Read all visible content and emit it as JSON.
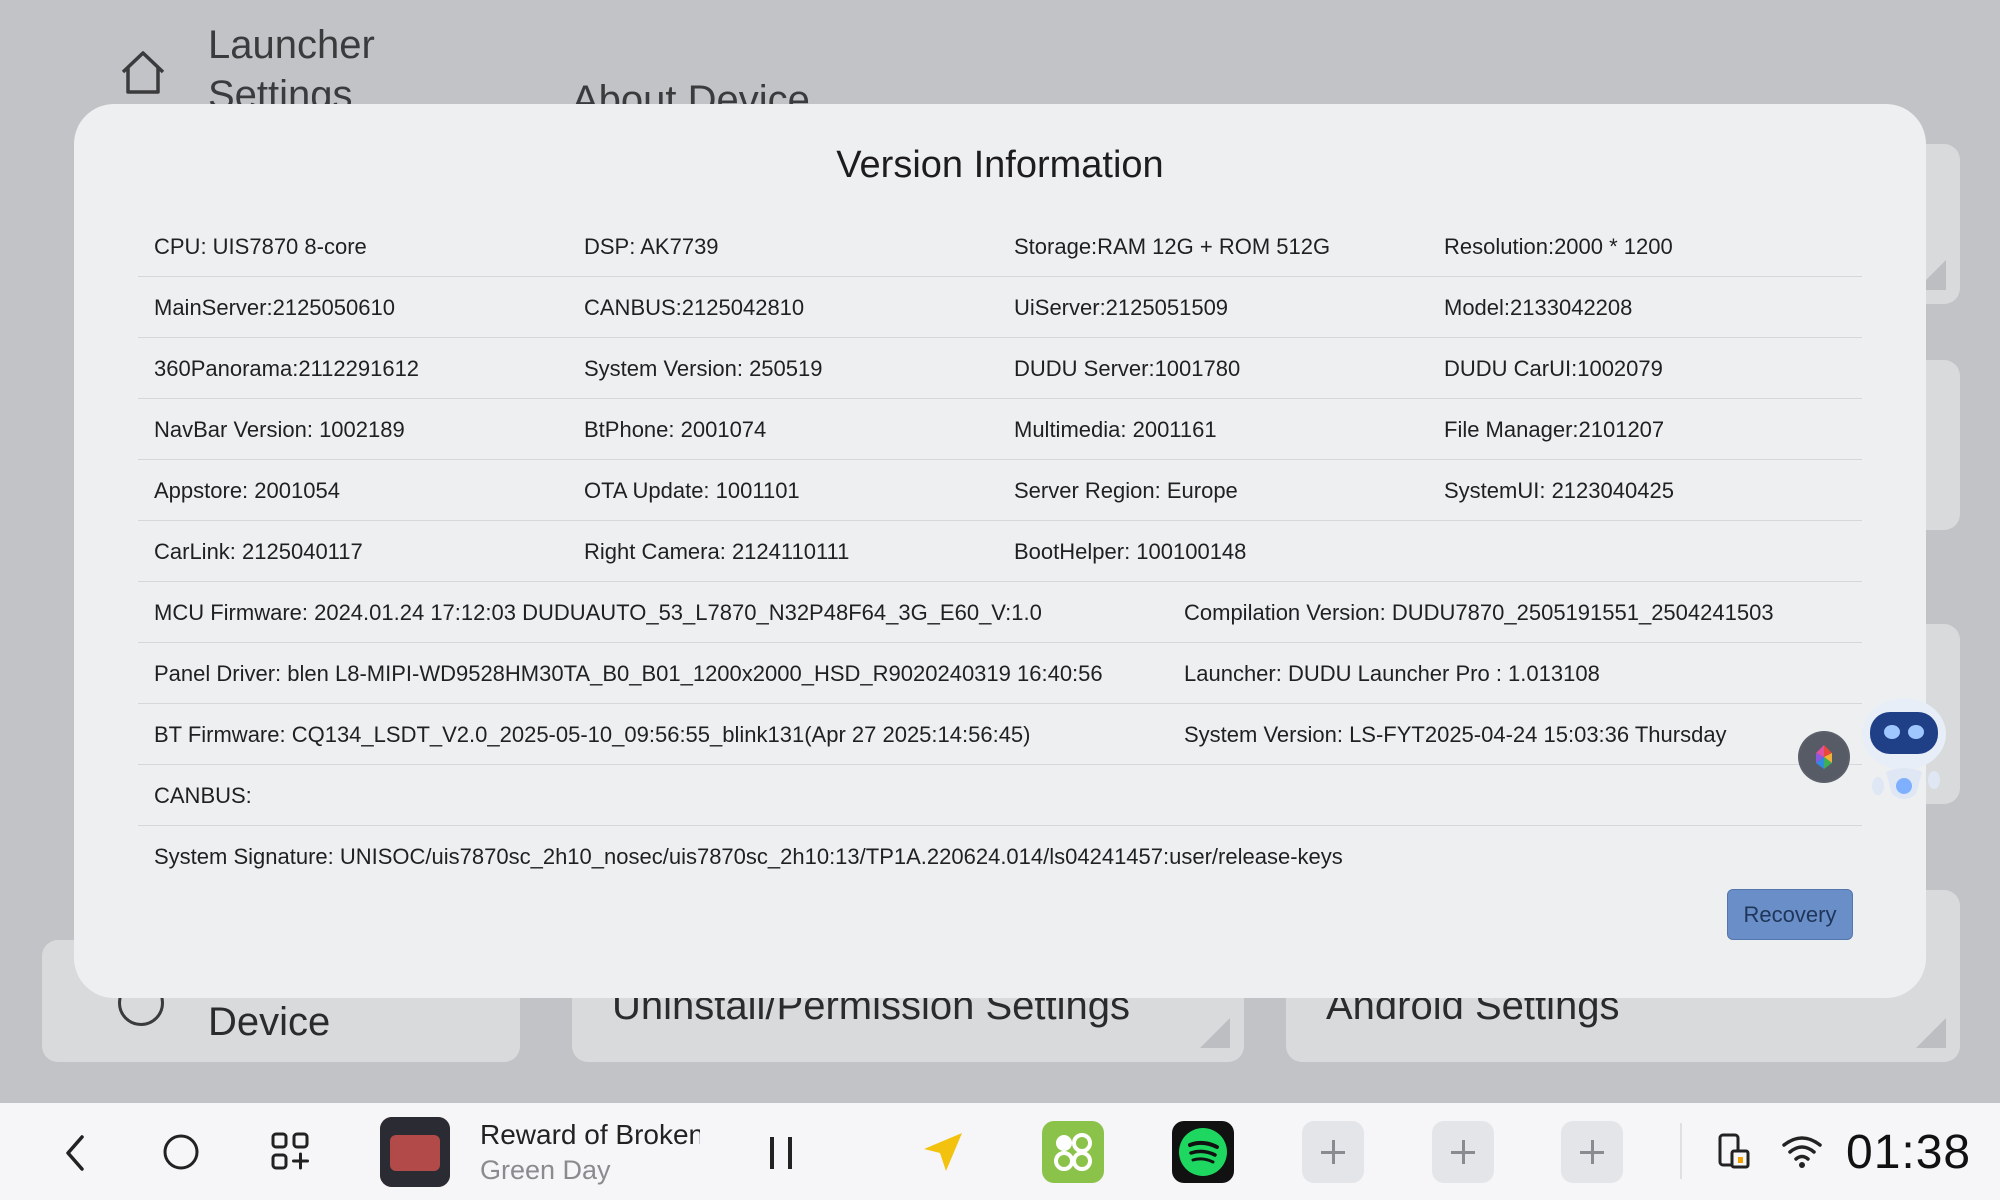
{
  "background": {
    "header_title": "Launcher Settings",
    "about_title": "About Device",
    "cards": {
      "device": "Device",
      "uninstall": "Uninstall/Permission Settings",
      "android": "Android Settings"
    }
  },
  "modal": {
    "title": "Version Information",
    "rows4": [
      [
        "CPU:  UIS7870 8-core",
        "DSP:  AK7739",
        "Storage:RAM 12G + ROM 512G",
        "Resolution:2000 * 1200"
      ],
      [
        "MainServer:2125050610",
        "CANBUS:2125042810",
        "UiServer:2125051509",
        "Model:2133042208"
      ],
      [
        "360Panorama:2112291612",
        "System Version:  250519",
        "DUDU Server:1001780",
        "DUDU CarUI:1002079"
      ],
      [
        "NavBar Version:  1002189",
        "BtPhone:   2001074",
        "Multimedia:   2001161",
        "File Manager:2101207"
      ],
      [
        "Appstore:   2001054",
        "OTA Update:   1001101",
        "Server Region:  Europe",
        "SystemUI:   2123040425"
      ],
      [
        "CarLink:   2125040117",
        "Right Camera:   2124110111",
        "BootHelper: 100100148",
        ""
      ]
    ],
    "rows2": [
      [
        "MCU Firmware:  2024.01.24 17:12:03 DUDUAUTO_53_L7870_N32P48F64_3G_E60_V:1.0",
        "Compilation Version:  DUDU7870_2505191551_2504241503"
      ],
      [
        "Panel Driver:  blen L8-MIPI-WD9528HM30TA_B0_B01_1200x2000_HSD_R9020240319 16:40:56",
        "Launcher:  DUDU Launcher Pro : 1.013108"
      ],
      [
        "BT Firmware:  CQ134_LSDT_V2.0_2025-05-10_09:56:55_blink131(Apr 27 2025:14:56:45)",
        "System Version:  LS-FYT2025-04-24 15:03:36 Thursday"
      ]
    ],
    "rows1": [
      "CANBUS:",
      "System Signature:  UNISOC/uis7870sc_2h10_nosec/uis7870sc_2h10:13/TP1A.220624.014/ls04241457:user/release-keys"
    ],
    "recovery_label": "Recovery"
  },
  "navbar": {
    "track": "Reward of Broken Dreams",
    "artist": "Green Day",
    "clock": "01:38"
  },
  "colors": {
    "accent": "#6a8fc8",
    "app_green": "#8bc34a",
    "spotify": "#1ed760",
    "nav_arrow": "#f2c20f"
  }
}
